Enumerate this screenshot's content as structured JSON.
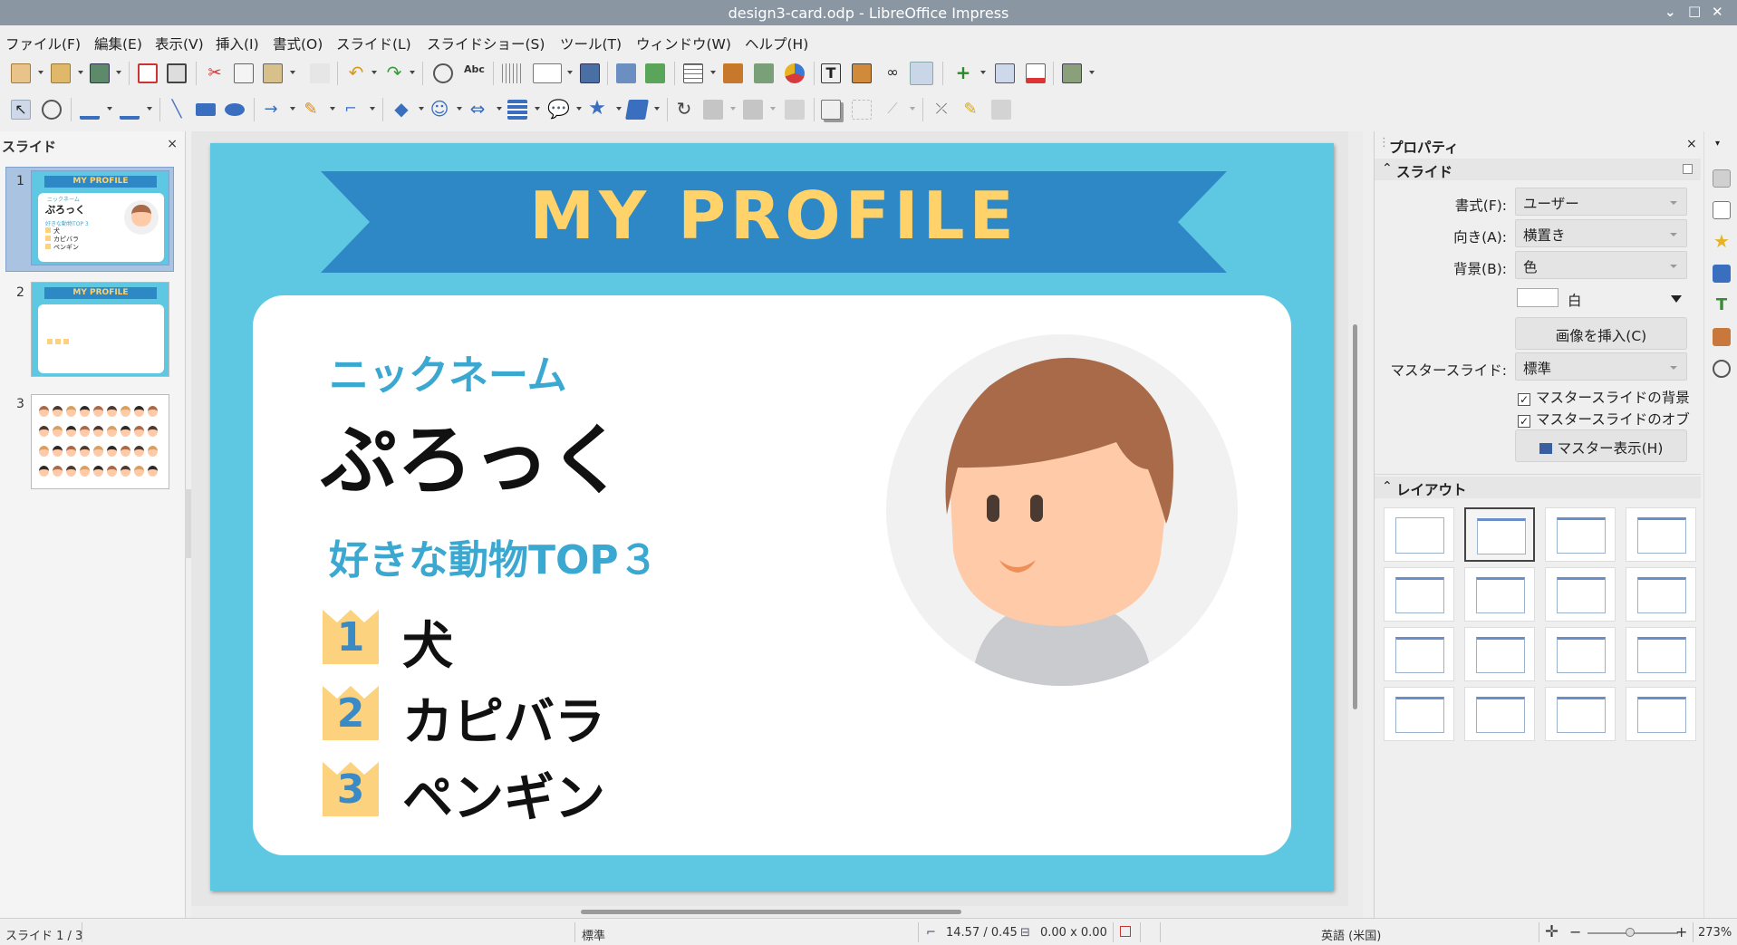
{
  "window": {
    "title": "design3-card.odp - LibreOffice Impress"
  },
  "menu": [
    "ファイル(F)",
    "編集(E)",
    "表示(V)",
    "挿入(I)",
    "書式(O)",
    "スライド(L)",
    "スライドショー(S)",
    "ツール(T)",
    "ウィンドウ(W)",
    "ヘルプ(H)"
  ],
  "slide_panel": {
    "title": "スライド",
    "close": "×",
    "numbers": [
      "1",
      "2",
      "3"
    ]
  },
  "thumb1": {
    "title": "MY PROFILE",
    "label": "ニックネーム",
    "name": "ぷろっく",
    "sub": "好きな動物TOP 3",
    "items": [
      "犬",
      "カピバラ",
      "ペンギン"
    ]
  },
  "thumb2": {
    "title": "MY PROFILE"
  },
  "slide": {
    "banner": "MY PROFILE",
    "nickname_label": "ニックネーム",
    "nickname": "ぷろっく",
    "top3_label": "好きな動物TOP３",
    "ranks": [
      {
        "num": "1",
        "name": "犬"
      },
      {
        "num": "2",
        "name": "カピバラ"
      },
      {
        "num": "3",
        "name": "ペンギン"
      }
    ]
  },
  "properties": {
    "title": "プロパティ",
    "close": "×",
    "slide_section": "スライド",
    "format_label": "書式(F):",
    "format_value": "ユーザー",
    "orientation_label": "向き(A):",
    "orientation_value": "横置き",
    "background_label": "背景(B):",
    "background_value": "色",
    "color_name": "白",
    "insert_image": "画像を挿入(C)",
    "master_label": "マスタースライド:",
    "master_value": "標準",
    "check_bg": "マスタースライドの背景",
    "check_obj": "マスタースライドのオブジェクト",
    "master_view": "マスター表示(H)",
    "layout_section": "レイアウト"
  },
  "status": {
    "slide": "スライド 1 / 3",
    "master": "標準",
    "position": "14.57 / 0.45",
    "size": "0.00 x 0.00",
    "language": "英語 (米国)",
    "zoom": "273%"
  },
  "colors": {
    "slide_bg": "#5ec7e2",
    "ribbon": "#2f88c6",
    "banner_text": "#ffd36a",
    "accent_text": "#3aa8d0",
    "crown": "#fdd27e",
    "rank_num": "#3a8ac6"
  }
}
